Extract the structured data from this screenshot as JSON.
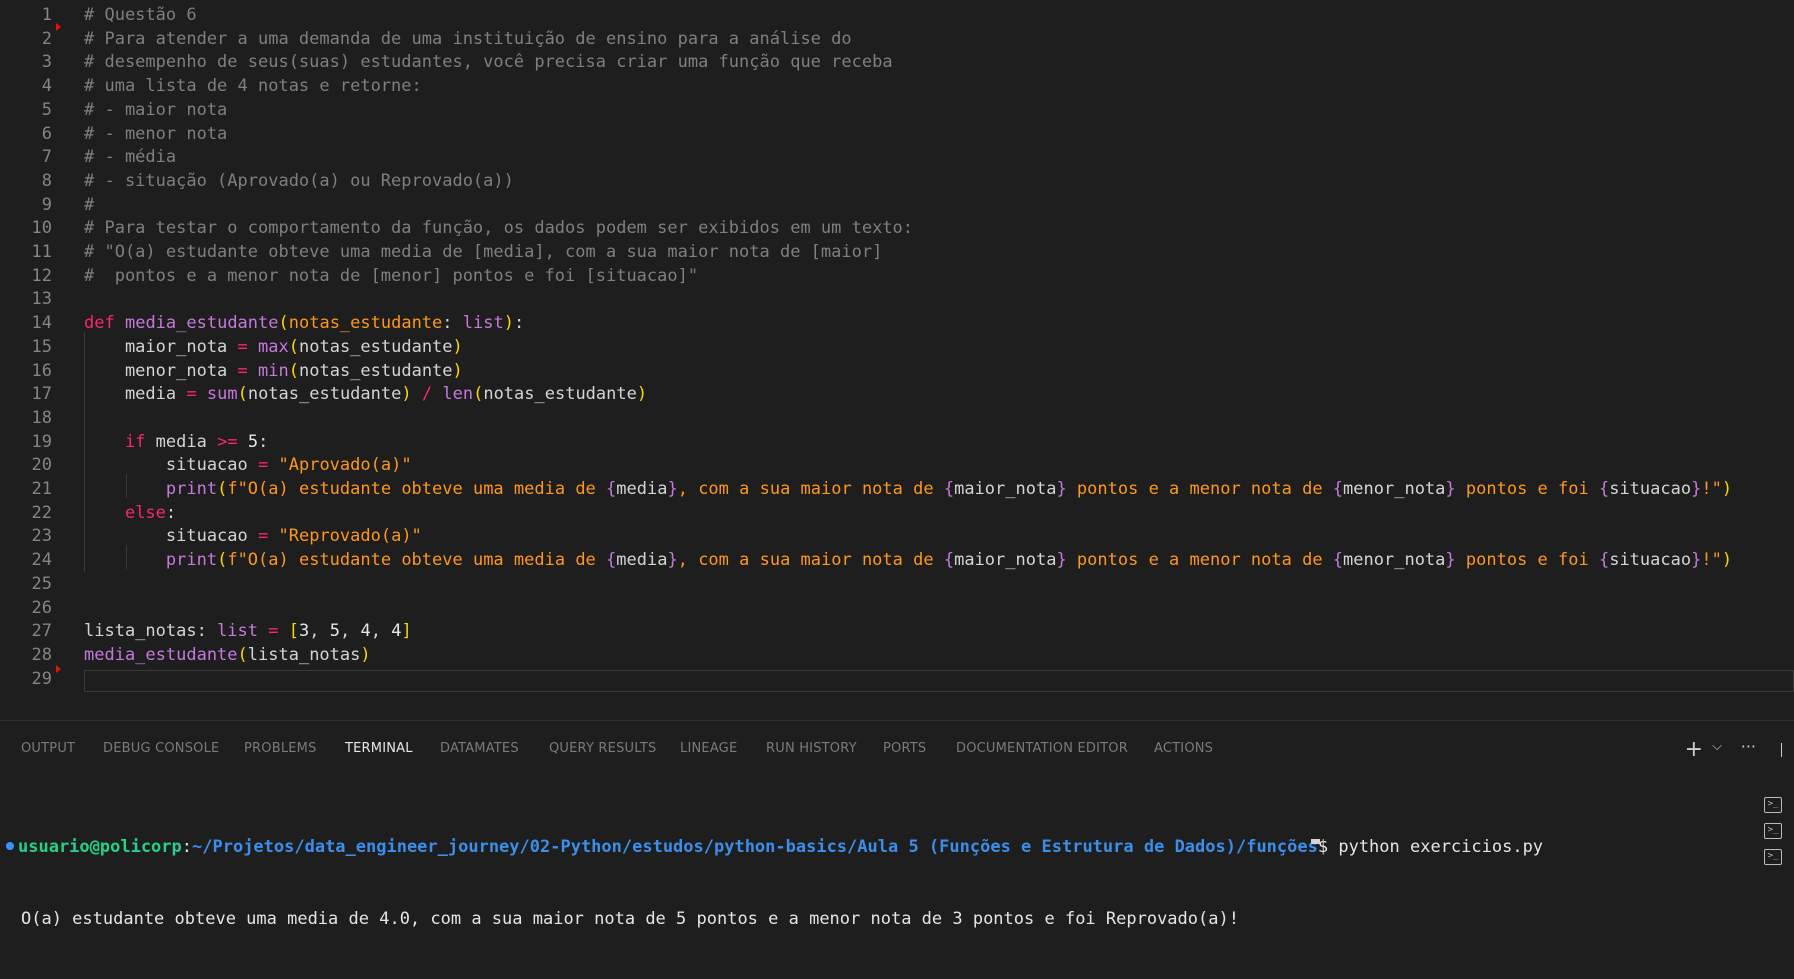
{
  "editor": {
    "lines": [
      {
        "n": "1",
        "tokens": [
          [
            "c-com",
            "# Questão 6"
          ]
        ]
      },
      {
        "n": "2",
        "tokens": [
          [
            "c-com",
            "# Para atender a uma demanda de uma instituição de ensino para a análise do"
          ]
        ]
      },
      {
        "n": "3",
        "tokens": [
          [
            "c-com",
            "# desempenho de seus(suas) estudantes, você precisa criar uma função que receba"
          ]
        ]
      },
      {
        "n": "4",
        "tokens": [
          [
            "c-com",
            "# uma lista de 4 notas e retorne:"
          ]
        ]
      },
      {
        "n": "5",
        "tokens": [
          [
            "c-com",
            "# - maior nota"
          ]
        ]
      },
      {
        "n": "6",
        "tokens": [
          [
            "c-com",
            "# - menor nota"
          ]
        ]
      },
      {
        "n": "7",
        "tokens": [
          [
            "c-com",
            "# - média"
          ]
        ]
      },
      {
        "n": "8",
        "tokens": [
          [
            "c-com",
            "# - situação (Aprovado(a) ou Reprovado(a))"
          ]
        ]
      },
      {
        "n": "9",
        "tokens": [
          [
            "c-com",
            "#"
          ]
        ]
      },
      {
        "n": "10",
        "tokens": [
          [
            "c-com",
            "# Para testar o comportamento da função, os dados podem ser exibidos em um texto:"
          ]
        ]
      },
      {
        "n": "11",
        "tokens": [
          [
            "c-com",
            "# \"O(a) estudante obteve uma media de [media], com a sua maior nota de [maior]"
          ]
        ]
      },
      {
        "n": "12",
        "tokens": [
          [
            "c-com",
            "#  pontos e a menor nota de [menor] pontos e foi [situacao]\""
          ]
        ]
      },
      {
        "n": "13",
        "tokens": []
      },
      {
        "n": "14",
        "tokens": [
          [
            "c-kw",
            "def"
          ],
          [
            "c-txt",
            " "
          ],
          [
            "c-def",
            "media_estudante"
          ],
          [
            "c-p1",
            "("
          ],
          [
            "c-param",
            "notas_estudante"
          ],
          [
            "c-txt",
            ": "
          ],
          [
            "c-builtin",
            "list"
          ],
          [
            "c-p1",
            ")"
          ],
          [
            "c-txt",
            ":"
          ]
        ]
      },
      {
        "n": "15",
        "tokens": [
          [
            "c-txt",
            "    maior_nota "
          ],
          [
            "c-op",
            "="
          ],
          [
            "c-txt",
            " "
          ],
          [
            "c-builtin",
            "max"
          ],
          [
            "c-p1",
            "("
          ],
          [
            "c-txt",
            "notas_estudante"
          ],
          [
            "c-p1",
            ")"
          ]
        ]
      },
      {
        "n": "16",
        "tokens": [
          [
            "c-txt",
            "    menor_nota "
          ],
          [
            "c-op",
            "="
          ],
          [
            "c-txt",
            " "
          ],
          [
            "c-builtin",
            "min"
          ],
          [
            "c-p1",
            "("
          ],
          [
            "c-txt",
            "notas_estudante"
          ],
          [
            "c-p1",
            ")"
          ]
        ]
      },
      {
        "n": "17",
        "tokens": [
          [
            "c-txt",
            "    media "
          ],
          [
            "c-op",
            "="
          ],
          [
            "c-txt",
            " "
          ],
          [
            "c-builtin",
            "sum"
          ],
          [
            "c-p1",
            "("
          ],
          [
            "c-txt",
            "notas_estudante"
          ],
          [
            "c-p1",
            ")"
          ],
          [
            "c-txt",
            " "
          ],
          [
            "c-op",
            "/"
          ],
          [
            "c-txt",
            " "
          ],
          [
            "c-builtin",
            "len"
          ],
          [
            "c-p1",
            "("
          ],
          [
            "c-txt",
            "notas_estudante"
          ],
          [
            "c-p1",
            ")"
          ]
        ]
      },
      {
        "n": "18",
        "tokens": []
      },
      {
        "n": "19",
        "tokens": [
          [
            "c-txt",
            "    "
          ],
          [
            "c-kw",
            "if"
          ],
          [
            "c-txt",
            " media "
          ],
          [
            "c-op",
            ">="
          ],
          [
            "c-txt",
            " "
          ],
          [
            "c-num",
            "5"
          ],
          [
            "c-txt",
            ":"
          ]
        ]
      },
      {
        "n": "20",
        "tokens": [
          [
            "c-txt",
            "        situacao "
          ],
          [
            "c-op",
            "="
          ],
          [
            "c-txt",
            " "
          ],
          [
            "c-str",
            "\"Aprovado(a)\""
          ]
        ]
      },
      {
        "n": "21",
        "tokens": [
          [
            "c-txt",
            "        "
          ],
          [
            "c-builtin",
            "print"
          ],
          [
            "c-p1",
            "("
          ],
          [
            "c-str",
            "f\"O(a) estudante obteve uma media de "
          ],
          [
            "c-brace",
            "{"
          ],
          [
            "c-txt",
            "media"
          ],
          [
            "c-brace",
            "}"
          ],
          [
            "c-str",
            ", com a sua maior nota de "
          ],
          [
            "c-brace",
            "{"
          ],
          [
            "c-txt",
            "maior_nota"
          ],
          [
            "c-brace",
            "}"
          ],
          [
            "c-str",
            " pontos e a menor nota de "
          ],
          [
            "c-brace",
            "{"
          ],
          [
            "c-txt",
            "menor_nota"
          ],
          [
            "c-brace",
            "}"
          ],
          [
            "c-str",
            " pontos e foi "
          ],
          [
            "c-brace",
            "{"
          ],
          [
            "c-txt",
            "situacao"
          ],
          [
            "c-brace",
            "}"
          ],
          [
            "c-str",
            "!\""
          ],
          [
            "c-p1",
            ")"
          ]
        ]
      },
      {
        "n": "22",
        "tokens": [
          [
            "c-txt",
            "    "
          ],
          [
            "c-kw",
            "else"
          ],
          [
            "c-txt",
            ":"
          ]
        ]
      },
      {
        "n": "23",
        "tokens": [
          [
            "c-txt",
            "        situacao "
          ],
          [
            "c-op",
            "="
          ],
          [
            "c-txt",
            " "
          ],
          [
            "c-str",
            "\"Reprovado(a)\""
          ]
        ]
      },
      {
        "n": "24",
        "tokens": [
          [
            "c-txt",
            "        "
          ],
          [
            "c-builtin",
            "print"
          ],
          [
            "c-p1",
            "("
          ],
          [
            "c-str",
            "f\"O(a) estudante obteve uma media de "
          ],
          [
            "c-brace",
            "{"
          ],
          [
            "c-txt",
            "media"
          ],
          [
            "c-brace",
            "}"
          ],
          [
            "c-str",
            ", com a sua maior nota de "
          ],
          [
            "c-brace",
            "{"
          ],
          [
            "c-txt",
            "maior_nota"
          ],
          [
            "c-brace",
            "}"
          ],
          [
            "c-str",
            " pontos e a menor nota de "
          ],
          [
            "c-brace",
            "{"
          ],
          [
            "c-txt",
            "menor_nota"
          ],
          [
            "c-brace",
            "}"
          ],
          [
            "c-str",
            " pontos e foi "
          ],
          [
            "c-brace",
            "{"
          ],
          [
            "c-txt",
            "situacao"
          ],
          [
            "c-brace",
            "}"
          ],
          [
            "c-str",
            "!\""
          ],
          [
            "c-p1",
            ")"
          ]
        ]
      },
      {
        "n": "25",
        "tokens": []
      },
      {
        "n": "26",
        "tokens": []
      },
      {
        "n": "27",
        "tokens": [
          [
            "c-txt",
            "lista_notas: "
          ],
          [
            "c-builtin",
            "list"
          ],
          [
            "c-txt",
            " "
          ],
          [
            "c-op",
            "="
          ],
          [
            "c-txt",
            " "
          ],
          [
            "c-p1",
            "["
          ],
          [
            "c-num",
            "3"
          ],
          [
            "c-txt",
            ", "
          ],
          [
            "c-num",
            "5"
          ],
          [
            "c-txt",
            ", "
          ],
          [
            "c-num",
            "4"
          ],
          [
            "c-txt",
            ", "
          ],
          [
            "c-num",
            "4"
          ],
          [
            "c-p1",
            "]"
          ]
        ]
      },
      {
        "n": "28",
        "tokens": [
          [
            "c-def",
            "media_estudante"
          ],
          [
            "c-p1",
            "("
          ],
          [
            "c-txt",
            "lista_notas"
          ],
          [
            "c-p1",
            ")"
          ]
        ]
      },
      {
        "n": "29",
        "tokens": []
      }
    ]
  },
  "panel": {
    "tabs": [
      {
        "label": "OUTPUT",
        "name": "tab-output"
      },
      {
        "label": "DEBUG CONSOLE",
        "name": "tab-debug-console"
      },
      {
        "label": "PROBLEMS",
        "name": "tab-problems"
      },
      {
        "label": "TERMINAL",
        "name": "tab-terminal",
        "active": true
      },
      {
        "label": "DATAMATES",
        "name": "tab-datamates"
      },
      {
        "label": "QUERY RESULTS",
        "name": "tab-query-results"
      },
      {
        "label": "LINEAGE",
        "name": "tab-lineage"
      },
      {
        "label": "RUN HISTORY",
        "name": "tab-run-history"
      },
      {
        "label": "PORTS",
        "name": "tab-ports"
      },
      {
        "label": "DOCUMENTATION EDITOR",
        "name": "tab-documentation-editor"
      },
      {
        "label": "ACTIONS",
        "name": "tab-actions"
      }
    ],
    "actions": {
      "add": "+",
      "dropdown": "⌵",
      "more": "···"
    }
  },
  "terminal": {
    "user": "usuario@policorp",
    "sep": ":",
    "path": "~/Projetos/data_engineer_journey/02-Python/estudos/python-basics/Aula 5 (Funções e Estrutura de Dados)/funções",
    "prompt": "$",
    "command": " python exercicios.py",
    "output": "O(a) estudante obteve uma media de 4.0, com a sua maior nota de 5 pontos e a menor nota de 3 pontos e foi Reprovado(a)!"
  }
}
